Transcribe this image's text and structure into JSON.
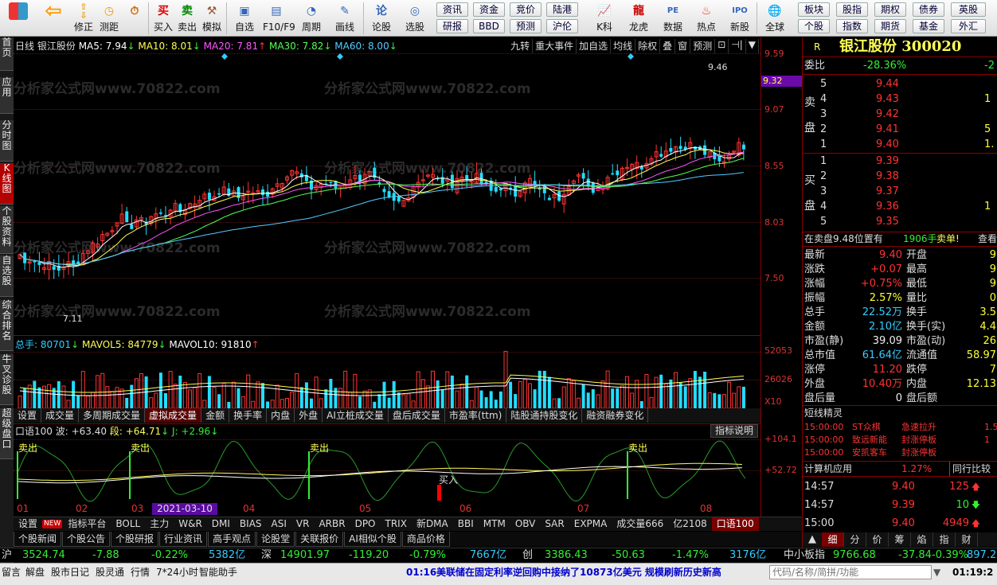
{
  "toolbar": {
    "buttons": [
      {
        "key": "home",
        "label": ""
      },
      {
        "key": "back",
        "label": ""
      },
      {
        "key": "up",
        "label": "修正"
      },
      {
        "key": "measure",
        "label": "测距"
      },
      {
        "key": "buy",
        "label": "买入"
      },
      {
        "key": "sell",
        "label": "卖出"
      },
      {
        "key": "simulate",
        "label": "模拟"
      },
      {
        "key": "watchlist",
        "label": "自选"
      },
      {
        "key": "f10",
        "label": "F10/F9"
      },
      {
        "key": "period",
        "label": "周期"
      },
      {
        "key": "draw",
        "label": "画线"
      },
      {
        "key": "forum",
        "label": "论股"
      },
      {
        "key": "picker",
        "label": "选股"
      },
      {
        "key": "kdiag",
        "label": "K科"
      },
      {
        "key": "dragon",
        "label": "龙虎"
      },
      {
        "key": "data",
        "label": "数据"
      },
      {
        "key": "hot",
        "label": "热点"
      },
      {
        "key": "ipo",
        "label": "新股"
      },
      {
        "key": "global",
        "label": "全球"
      }
    ],
    "quick_row1": [
      "资讯",
      "资金",
      "竞价",
      "陆港"
    ],
    "quick_row2": [
      "研报",
      "BBD",
      "预测",
      "沪伦"
    ],
    "quick_right_row1": [
      "板块",
      "股指",
      "期权",
      "债券",
      "英股"
    ],
    "quick_right_row2": [
      "个股",
      "指数",
      "期货",
      "基金",
      "外汇"
    ]
  },
  "sidebar": {
    "tabs": [
      "首页",
      "应用",
      "分时图",
      "K线图",
      "个股资料",
      "自选股",
      "综合排名",
      "牛叉诊股",
      "超级盘口"
    ],
    "active": "K线图"
  },
  "chart": {
    "period": "日线",
    "stock_name": "银江股份",
    "ma5": "MA5: 7.94",
    "ma10": "MA10: 8.01",
    "ma20": "MA20: 7.81",
    "ma30": "MA30: 7.82",
    "ma60": "MA60: 8.00",
    "top_buttons": [
      "九转",
      "重大事件",
      "加自选",
      "均线",
      "除权",
      "叠",
      "窗",
      "预测",
      "⊡",
      "⊣|",
      "▼"
    ],
    "price_axis": [
      "9.59",
      "9.07",
      "8.55",
      "8.03",
      "7.50"
    ],
    "current_price_tag": "9.32",
    "high_mark": "9.46",
    "low_mark": "7.11",
    "volume_info": {
      "total": "总手: 80701",
      "mavol5": "MAVOL5: 84779",
      "mavol10": "MAVOL10: 91810"
    },
    "volume_axis": [
      "52053",
      "26026",
      "X10"
    ],
    "indicator_tabs": [
      "设置",
      "成交量",
      "多周期成交量",
      "虚拟成交量",
      "金额",
      "换手率",
      "内盘",
      "外盘",
      "AI立桩成交量",
      "盘后成交量",
      "市盈率(ttm)",
      "陆股通持股变化",
      "融资融券变化"
    ],
    "indicator_active": "虚拟成交量",
    "osc_info": {
      "name": "口语100",
      "wave": "波: +63.40",
      "seg": "段: +64.71",
      "j": "J: +2.96"
    },
    "osc_button": "指标说明",
    "osc_axis": [
      "+104.1",
      "+52.72"
    ],
    "signals": [
      "卖出",
      "卖出",
      "卖出",
      "买入",
      "卖出"
    ],
    "months": [
      "01",
      "02",
      "03",
      "04",
      "05",
      "06",
      "07",
      "08"
    ],
    "cursor_date": "2021-03-10 三",
    "watermark": "分析家公式网www.70822.com"
  },
  "indicator_strip": [
    "设置",
    "NEW",
    "指标平台",
    "BOLL",
    "主力",
    "W&R",
    "DMI",
    "BIAS",
    "ASI",
    "VR",
    "ARBR",
    "DPO",
    "TRIX",
    "新DMA",
    "BBI",
    "MTM",
    "OBV",
    "SAR",
    "EXPMA",
    "成交量666",
    "亿2108",
    "口语100"
  ],
  "indicator_strip_active": "口语100",
  "news_tabs": [
    "个股新闻",
    "个股公告",
    "个股研报",
    "行业资讯",
    "高手观点",
    "论股堂",
    "关联报价",
    "AI相似个股",
    "商品价格"
  ],
  "index_bar": {
    "sh": {
      "name": "沪",
      "value": "3524.74",
      "chg": "-7.88",
      "pct": "-0.22%",
      "amt": "5382亿"
    },
    "sz": {
      "name": "深",
      "value": "14901.97",
      "chg": "-119.20",
      "pct": "-0.79%",
      "amt": "7667亿"
    },
    "cy": {
      "name": "创",
      "value": "3386.43",
      "chg": "-50.63",
      "pct": "-1.47%",
      "amt": "3176亿"
    },
    "zx": {
      "name": "中小板指",
      "value": "9766.68",
      "chg": "-37.84",
      "pct": "-0.39%",
      "amt": "897.2"
    }
  },
  "status_bar": {
    "items": [
      "留言",
      "解盘",
      "股市日记",
      "股灵通",
      "行情",
      "7*24小时",
      "智能助手"
    ],
    "news_time": "01:16",
    "news_text": "美联储在固定利率逆回购中接纳了10873亿美元 规模刷新历史新高",
    "search_placeholder": "代码/名称/简拼/功能",
    "clock": "01:19:2"
  },
  "quote_panel": {
    "r_label": "R",
    "title": "银江股份 300020",
    "weibi_label": "委比",
    "weibi_value": "-28.36%",
    "weibi_extra": "-2",
    "sell_label": "卖盘",
    "buy_label": "买盘",
    "asks": [
      {
        "level": "5",
        "price": "9.44",
        "vol": ""
      },
      {
        "level": "4",
        "price": "9.43",
        "vol": "1"
      },
      {
        "level": "3",
        "price": "9.42",
        "vol": ""
      },
      {
        "level": "2",
        "price": "9.41",
        "vol": "5"
      },
      {
        "level": "1",
        "price": "9.40",
        "vol": "1."
      }
    ],
    "bids": [
      {
        "level": "1",
        "price": "9.39",
        "vol": ""
      },
      {
        "level": "2",
        "price": "9.38",
        "vol": ""
      },
      {
        "level": "3",
        "price": "9.37",
        "vol": ""
      },
      {
        "level": "4",
        "price": "9.36",
        "vol": "1"
      },
      {
        "level": "5",
        "price": "9.35",
        "vol": ""
      }
    ],
    "order_note": "在卖盘9.48位置有",
    "order_vol": "1906手",
    "order_tag": "卖单!",
    "order_link": "查看",
    "stats": [
      {
        "l1": "最新",
        "v1": "9.40",
        "c1": "red",
        "l2": "开盘",
        "v2": "9"
      },
      {
        "l1": "涨跌",
        "v1": "+0.07",
        "c1": "red",
        "l2": "最高",
        "v2": "9"
      },
      {
        "l1": "涨幅",
        "v1": "+0.75%",
        "c1": "red",
        "l2": "最低",
        "v2": "9"
      },
      {
        "l1": "振幅",
        "v1": "2.57%",
        "c1": "yellow",
        "l2": "量比",
        "v2": "0"
      },
      {
        "l1": "总手",
        "v1": "22.52万",
        "c1": "cyan",
        "l2": "换手",
        "v2": "3.5"
      },
      {
        "l1": "金额",
        "v1": "2.10亿",
        "c1": "cyan",
        "l2": "换手(实)",
        "v2": "4.4"
      },
      {
        "l1": "市盈(静)",
        "v1": "39.09",
        "c1": "white",
        "l2": "市盈(动)",
        "v2": "26"
      },
      {
        "l1": "总市值",
        "v1": "61.64亿",
        "c1": "cyan",
        "l2": "流通值",
        "v2": "58.97"
      },
      {
        "l1": "涨停",
        "v1": "11.20",
        "c1": "red",
        "l2": "跌停",
        "v2": "7"
      },
      {
        "l1": "外盘",
        "v1": "10.40万",
        "c1": "red",
        "l2": "内盘",
        "v2": "12.13"
      },
      {
        "l1": "盘后量",
        "v1": "0",
        "c1": "white",
        "l2": "盘后额",
        "v2": ""
      }
    ],
    "short_wizard_label": "短线精灵",
    "wizard": [
      {
        "time": "15:00:00",
        "name": "ST众棋",
        "event": "急速拉升",
        "val": "1.5"
      },
      {
        "time": "15:00:00",
        "name": "致远新能",
        "event": "封涨停板",
        "val": "1"
      },
      {
        "time": "15:00:00",
        "name": "安凯客车",
        "event": "封涨停板",
        "val": ""
      }
    ],
    "industry_label": "计算机应用",
    "industry_pct": "1.27%",
    "industry_rank": "同行比较",
    "ticks": [
      {
        "time": "14:57",
        "price": "9.40",
        "vol": "125",
        "dir": "up"
      },
      {
        "time": "14:57",
        "price": "9.39",
        "vol": "10",
        "dir": "down"
      },
      {
        "time": "15:00",
        "price": "9.40",
        "vol": "4949",
        "dir": "up"
      }
    ],
    "bottom_tabs": [
      "细",
      "分",
      "价",
      "筹",
      "焰",
      "指",
      "财"
    ]
  },
  "colors": {
    "up": "#ff3333",
    "down": "#22ddff",
    "bg": "#000000",
    "ma5": "#ffffff",
    "ma10": "#ffff55",
    "ma20": "#ff55ff",
    "ma30": "#55ff55",
    "ma60": "#55ccff"
  }
}
